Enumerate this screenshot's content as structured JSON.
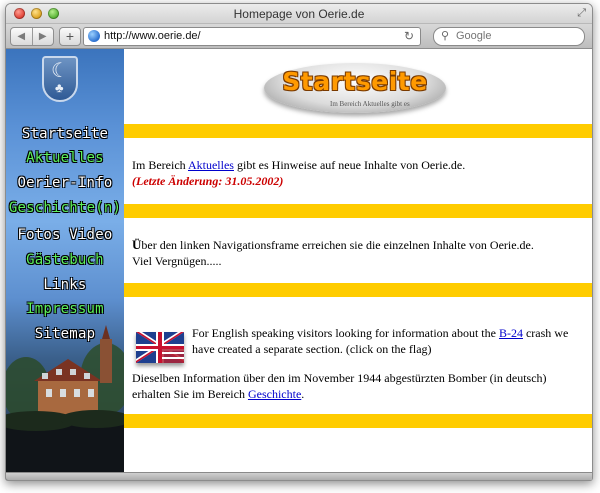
{
  "window": {
    "title": "Homepage von Oerie.de",
    "address": "http://www.oerie.de/",
    "search_placeholder": "Google"
  },
  "sidebar": {
    "items": [
      {
        "label": "Startseite",
        "color": "#ffffff"
      },
      {
        "label": "Aktuelles",
        "color": "#5cf05a"
      },
      {
        "label": "Oerier-Info",
        "color": "#ffffff"
      },
      {
        "label": "Geschichte(n)",
        "color": "#5cf05a"
      },
      {
        "label": "Fotos Video",
        "color": "#ffffff"
      },
      {
        "label": "Gästebuch",
        "color": "#5cf05a"
      },
      {
        "label": "Links",
        "color": "#ffffff"
      },
      {
        "label": "Impressum",
        "color": "#5cf05a"
      },
      {
        "label": "Sitemap",
        "color": "#ffffff"
      }
    ]
  },
  "main": {
    "logo_title": "Startseite",
    "logo_subtitle": "Im Bereich Aktuelles gibt es",
    "section1": {
      "text_before": "Im Bereich ",
      "link": "Aktuelles",
      "text_after": " gibt es Hinweise auf neue Inhalte von Oerie.de.",
      "update": "(Letzte Änderung: 31.05.2002)"
    },
    "section2": {
      "first_letter": "Ü",
      "line1": "ber den linken Navigationsframe erreichen sie die einzelnen Inhalte von Oerie.de.",
      "line2": "Viel Vergnügen....."
    },
    "section3": {
      "english_before": "For English speaking visitors looking for information about the ",
      "english_link": "B-24",
      "english_after": " crash we have created a separate section. (click on the flag)",
      "german_before": "Dieselben Information über den im November 1944 abgestürzten Bomber (in deutsch) erhalten Sie im Bereich ",
      "german_link": "Geschichte",
      "german_after": "."
    }
  },
  "colors": {
    "stripe": "#ffcc00",
    "link": "#0000cc",
    "update_text": "#cc0000",
    "logo_text": "#ff9a00"
  }
}
